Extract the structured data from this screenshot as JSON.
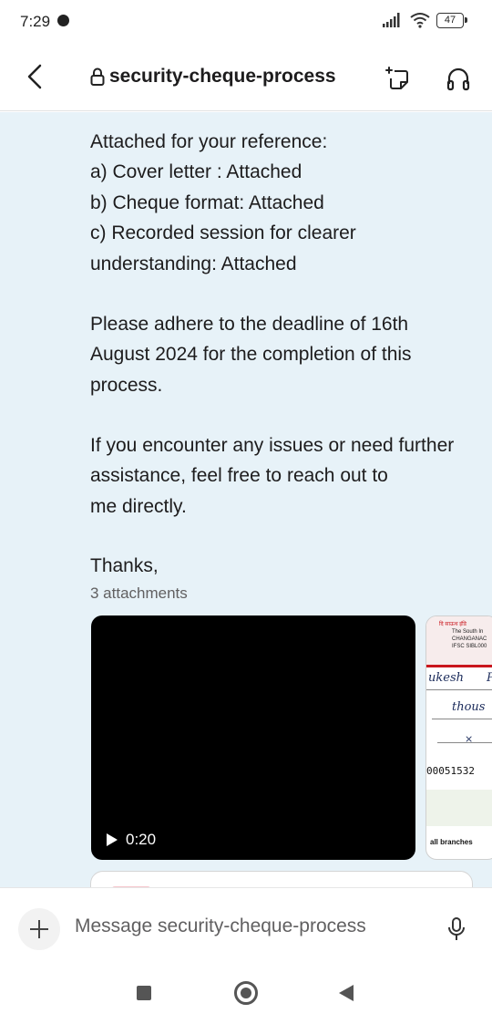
{
  "status_bar": {
    "time": "7:29",
    "battery": "47"
  },
  "header": {
    "channel_name": "security-cheque-process",
    "icons": [
      "back-chevron-icon",
      "lock-icon",
      "canvas-icon",
      "headphones-icon"
    ]
  },
  "message": {
    "paragraph1": [
      "Attached for your reference:",
      "a) Cover letter : Attached",
      "b) Cheque format: Attached",
      "c) Recorded session for clearer",
      "understanding: Attached"
    ],
    "paragraph2": [
      "Please adhere to the deadline of 16th",
      "August 2024 for the completion of this",
      "process."
    ],
    "paragraph3": [
      "If you encounter any issues or need further",
      "assistance, feel free to reach out to",
      "me directly."
    ],
    "signoff": "Thanks,",
    "attachments_label": "3 attachments"
  },
  "attachments": {
    "video": {
      "duration": "0:20"
    },
    "cheque_image": {
      "bank_line1": "दि साऊथ इंडि",
      "bank_line2": "The South In",
      "branch": "CHANGANAC",
      "ifsc": "IFSC SIBL000",
      "hand_line1": "ukesh",
      "hand_letter": "P",
      "hand_line2": "thous",
      "hand_mark": "×",
      "cheque_number": "00051532",
      "footer": "all branches"
    }
  },
  "composer": {
    "placeholder": "Message security-cheque-process"
  },
  "colors": {
    "content_bg": "#e7f2f8",
    "text": "#1d1c1d",
    "muted": "#616061"
  }
}
